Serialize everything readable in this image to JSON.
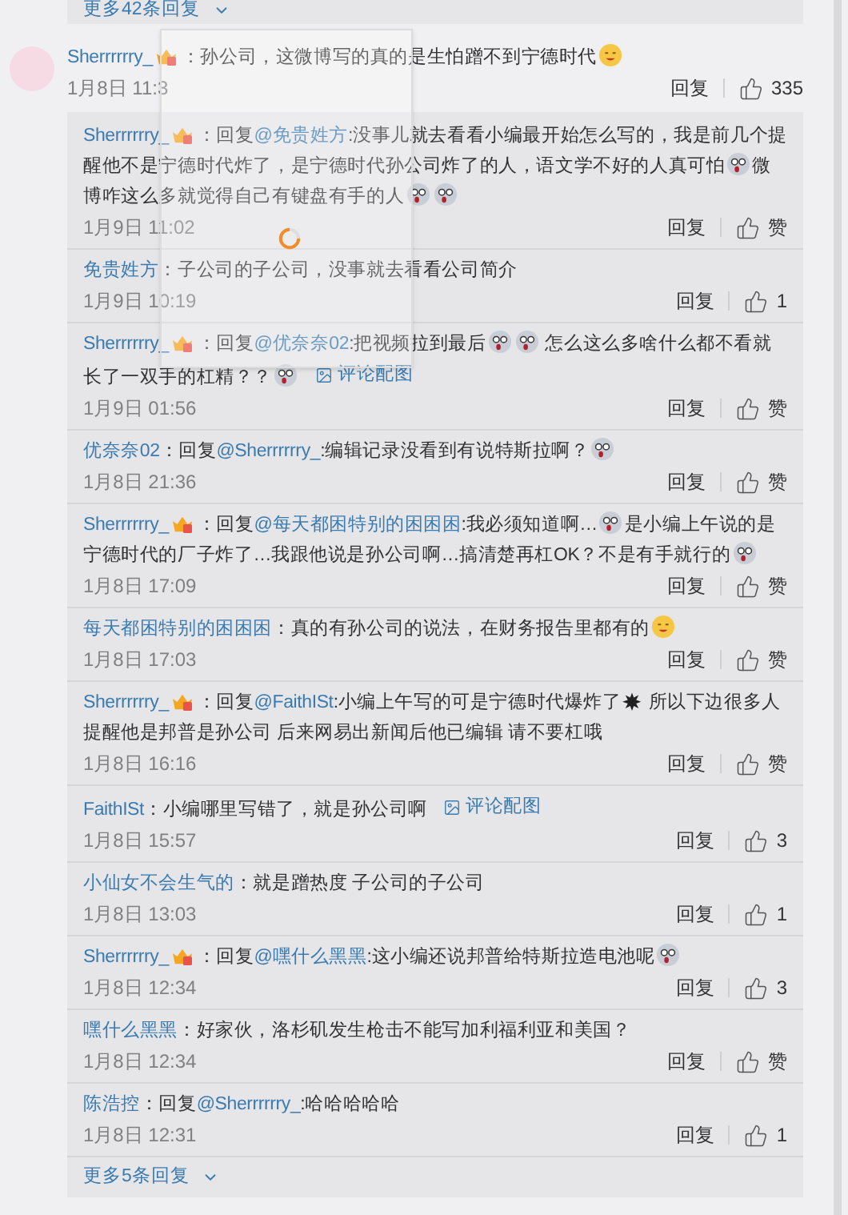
{
  "more_top": {
    "label": "更多42条回复"
  },
  "comment": {
    "user": "Sherrrrrry_",
    "badge": true,
    "segments": [
      {
        "kind": "text",
        "text": "：孙公司，这微博写的真的是生怕蹭不到宁德时代"
      },
      {
        "kind": "smiley"
      }
    ],
    "time": "1月8日 11:3",
    "reply_label": "回复",
    "like": "335"
  },
  "replies": [
    {
      "user": "Sherrrrrry_",
      "badge": true,
      "segments": [
        {
          "kind": "text",
          "text": "：回复"
        },
        {
          "kind": "mention",
          "text": "@免贵姓方"
        },
        {
          "kind": "text",
          "text": ":没事儿就去看看小编最开始怎么写的，我是前几个提醒他不是宁德时代炸了，是宁德时代孙公司炸了的人，语文学不好的人真可怕"
        },
        {
          "kind": "grimace"
        },
        {
          "kind": "text",
          "text": "微博咋这么多就觉得自己有键盘有手的人"
        },
        {
          "kind": "grimace"
        },
        {
          "kind": "grimace"
        }
      ],
      "time": "1月9日 11:02",
      "reply_label": "回复",
      "like": "赞"
    },
    {
      "user": "免贵姓方",
      "badge": false,
      "segments": [
        {
          "kind": "text",
          "text": "：子公司的子公司，没事就去看看公司简介"
        }
      ],
      "time": "1月9日 10:19",
      "reply_label": "回复",
      "like": "1"
    },
    {
      "user": "Sherrrrrry_",
      "badge": true,
      "segments": [
        {
          "kind": "text",
          "text": "：回复"
        },
        {
          "kind": "mention",
          "text": "@优奈奈02"
        },
        {
          "kind": "text",
          "text": ":把视频拉到最后"
        },
        {
          "kind": "grimace"
        },
        {
          "kind": "grimace"
        },
        {
          "kind": "text",
          "text": " 怎么这么多啥什么都不看就长了一双手的杠精？？"
        },
        {
          "kind": "grimace"
        }
      ],
      "image_link": "评论配图",
      "time": "1月9日 01:56",
      "reply_label": "回复",
      "like": "赞"
    },
    {
      "user": "优奈奈02",
      "badge": false,
      "segments": [
        {
          "kind": "text",
          "text": "：回复"
        },
        {
          "kind": "mention",
          "text": "@Sherrrrrry_"
        },
        {
          "kind": "text",
          "text": ":编辑记录没看到有说特斯拉啊？"
        },
        {
          "kind": "grimace"
        }
      ],
      "time": "1月8日 21:36",
      "reply_label": "回复",
      "like": "赞"
    },
    {
      "user": "Sherrrrrry_",
      "badge": true,
      "segments": [
        {
          "kind": "text",
          "text": "：回复"
        },
        {
          "kind": "mention",
          "text": "@每天都困特别的困困困"
        },
        {
          "kind": "text",
          "text": ":我必须知道啊…"
        },
        {
          "kind": "grimace"
        },
        {
          "kind": "text",
          "text": "是小编上午说的是宁德时代的厂子炸了…我跟他说是孙公司啊…搞清楚再杠OK？不是有手就行的"
        },
        {
          "kind": "grimace"
        }
      ],
      "time": "1月8日 17:09",
      "reply_label": "回复",
      "like": "赞"
    },
    {
      "user": "每天都困特别的困困困",
      "badge": false,
      "segments": [
        {
          "kind": "text",
          "text": "：真的有孙公司的说法，在财务报告里都有的"
        },
        {
          "kind": "smiley"
        }
      ],
      "time": "1月8日 17:03",
      "reply_label": "回复",
      "like": "赞"
    },
    {
      "user": "Sherrrrrry_",
      "badge": true,
      "segments": [
        {
          "kind": "text",
          "text": "：回复"
        },
        {
          "kind": "mention",
          "text": "@FaithISt"
        },
        {
          "kind": "text",
          "text": ":小编上午写的可是宁德时代爆炸了"
        },
        {
          "kind": "bomb"
        },
        {
          "kind": "text",
          "text": " 所以下边很多人提醒他是邦普是孙公司 后来网易出新闻后他已编辑 请不要杠哦"
        }
      ],
      "time": "1月8日 16:16",
      "reply_label": "回复",
      "like": "赞"
    },
    {
      "user": "FaithISt",
      "badge": false,
      "segments": [
        {
          "kind": "text",
          "text": "：小编哪里写错了，就是孙公司啊"
        }
      ],
      "image_link": "评论配图",
      "time": "1月8日 15:57",
      "reply_label": "回复",
      "like": "3"
    },
    {
      "user": "小仙女不会生气的",
      "badge": false,
      "segments": [
        {
          "kind": "text",
          "text": "：就是蹭热度 子公司的子公司"
        }
      ],
      "time": "1月8日 13:03",
      "reply_label": "回复",
      "like": "1"
    },
    {
      "user": "Sherrrrrry_",
      "badge": true,
      "segments": [
        {
          "kind": "text",
          "text": "：回复"
        },
        {
          "kind": "mention",
          "text": "@嘿什么黑黑"
        },
        {
          "kind": "text",
          "text": ":这小编还说邦普给特斯拉造电池呢"
        },
        {
          "kind": "grimace"
        }
      ],
      "time": "1月8日 12:34",
      "reply_label": "回复",
      "like": "3"
    },
    {
      "user": "嘿什么黑黑",
      "badge": false,
      "segments": [
        {
          "kind": "text",
          "text": "：好家伙，洛杉矶发生枪击不能写加利福利亚和美国？"
        }
      ],
      "time": "1月8日 12:34",
      "reply_label": "回复",
      "like": "赞"
    },
    {
      "user": "陈浩控",
      "badge": false,
      "segments": [
        {
          "kind": "text",
          "text": "：回复"
        },
        {
          "kind": "mention",
          "text": "@Sherrrrrry_"
        },
        {
          "kind": "text",
          "text": ":哈哈哈哈哈"
        }
      ],
      "time": "1月8日 12:31",
      "reply_label": "回复",
      "like": "1"
    }
  ],
  "more_bottom": {
    "label": "更多5条回复"
  },
  "popup": {
    "loading": true
  }
}
